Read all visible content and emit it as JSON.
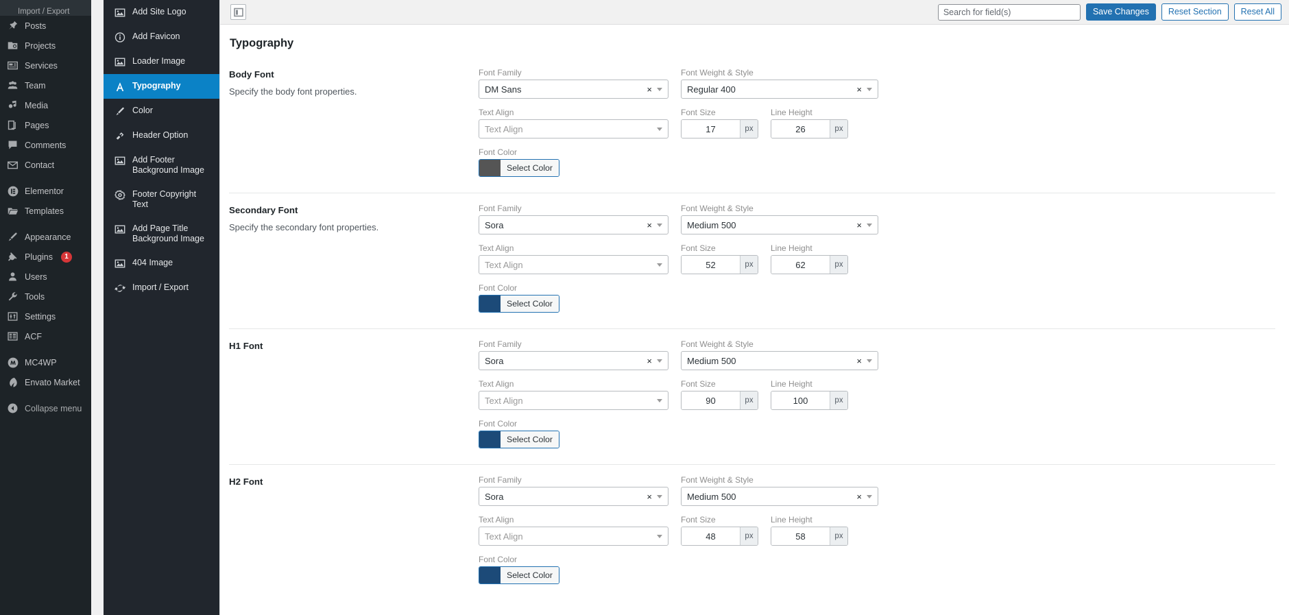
{
  "wp_sidebar": {
    "breadcrumb": "Import / Export",
    "items": [
      {
        "label": "Posts",
        "icon": "pin-icon",
        "name": "posts",
        "sep": false,
        "dim": false
      },
      {
        "label": "Projects",
        "icon": "projects-icon",
        "name": "projects",
        "sep": false,
        "dim": false
      },
      {
        "label": "Services",
        "icon": "services-icon",
        "name": "services",
        "sep": false,
        "dim": false
      },
      {
        "label": "Team",
        "icon": "team-icon",
        "name": "team",
        "sep": false,
        "dim": false
      },
      {
        "label": "Media",
        "icon": "media-icon",
        "name": "media",
        "sep": false,
        "dim": false
      },
      {
        "label": "Pages",
        "icon": "pages-icon",
        "name": "pages",
        "sep": false,
        "dim": false
      },
      {
        "label": "Comments",
        "icon": "comments-icon",
        "name": "comments",
        "sep": false,
        "dim": false
      },
      {
        "label": "Contact",
        "icon": "mail-icon",
        "name": "contact",
        "sep": false,
        "dim": false
      },
      {
        "label": "Elementor",
        "icon": "elementor-icon",
        "name": "elementor",
        "sep": true,
        "dim": false
      },
      {
        "label": "Templates",
        "icon": "folder-icon",
        "name": "templates",
        "sep": false,
        "dim": false
      },
      {
        "label": "Appearance",
        "icon": "brush-icon",
        "name": "appearance",
        "sep": true,
        "dim": false
      },
      {
        "label": "Plugins",
        "icon": "plug-icon",
        "name": "plugins",
        "sep": false,
        "dim": false,
        "badge": "1"
      },
      {
        "label": "Users",
        "icon": "user-icon",
        "name": "users",
        "sep": false,
        "dim": false
      },
      {
        "label": "Tools",
        "icon": "wrench-icon",
        "name": "tools",
        "sep": false,
        "dim": false
      },
      {
        "label": "Settings",
        "icon": "sliders-icon",
        "name": "settings",
        "sep": false,
        "dim": false
      },
      {
        "label": "ACF",
        "icon": "acf-icon",
        "name": "acf",
        "sep": false,
        "dim": false
      },
      {
        "label": "MC4WP",
        "icon": "mc4wp-icon",
        "name": "mc4wp",
        "sep": true,
        "dim": false
      },
      {
        "label": "Envato Market",
        "icon": "envato-icon",
        "name": "envato-market",
        "sep": false,
        "dim": false
      },
      {
        "label": "Collapse menu",
        "icon": "collapse-icon",
        "name": "collapse-menu",
        "sep": true,
        "dim": true
      }
    ]
  },
  "options_sidebar": {
    "items": [
      {
        "label": "Add Site Logo",
        "icon": "image-icon",
        "name": "add-site-logo",
        "active": false
      },
      {
        "label": "Add Favicon",
        "icon": "info-icon",
        "name": "add-favicon",
        "active": false
      },
      {
        "label": "Loader Image",
        "icon": "image-icon",
        "name": "loader-image",
        "active": false
      },
      {
        "label": "Typography",
        "icon": "typography-icon",
        "name": "typography",
        "active": true
      },
      {
        "label": "Color",
        "icon": "brush-icon",
        "name": "color",
        "active": false
      },
      {
        "label": "Header Option",
        "icon": "link-icon",
        "name": "header-option",
        "active": false
      },
      {
        "label": "Add Footer Background Image",
        "icon": "image-icon",
        "name": "add-footer-background-image",
        "active": false
      },
      {
        "label": "Footer Copyright Text",
        "icon": "gear-icon",
        "name": "footer-copyright-text",
        "active": false
      },
      {
        "label": "Add Page Title Background Image",
        "icon": "image-icon",
        "name": "add-page-title-background-image",
        "active": false
      },
      {
        "label": "404 Image",
        "icon": "image-icon",
        "name": "404-image",
        "active": false
      },
      {
        "label": "Import / Export",
        "icon": "refresh-icon",
        "name": "import-export",
        "active": false
      }
    ]
  },
  "topbar": {
    "expand_icon": "expand-panel-icon",
    "search_placeholder": "Search for field(s)",
    "search_value": "",
    "save_label": "Save Changes",
    "reset_section_label": "Reset Section",
    "reset_all_label": "Reset All"
  },
  "page": {
    "title": "Typography",
    "labels": {
      "font_family": "Font Family",
      "font_weight_style": "Font Weight & Style",
      "text_align": "Text Align",
      "font_size": "Font Size",
      "line_height": "Line Height",
      "font_color": "Font Color",
      "select_color": "Select Color",
      "unit_px": "px",
      "clear": "×"
    },
    "sections": [
      {
        "name": "body-font",
        "title": "Body Font",
        "desc": "Specify the body font properties.",
        "font_family": "DM Sans",
        "font_weight": "Regular 400",
        "text_align_placeholder": "Text Align",
        "font_size": "17",
        "line_height": "26",
        "color": "#555555"
      },
      {
        "name": "secondary-font",
        "title": "Secondary Font",
        "desc": "Specify the secondary font properties.",
        "font_family": "Sora",
        "font_weight": "Medium 500",
        "text_align_placeholder": "Text Align",
        "font_size": "52",
        "line_height": "62",
        "color": "#1c4a78"
      },
      {
        "name": "h1-font",
        "title": "H1 Font",
        "desc": "",
        "font_family": "Sora",
        "font_weight": "Medium 500",
        "text_align_placeholder": "Text Align",
        "font_size": "90",
        "line_height": "100",
        "color": "#1c4a78"
      },
      {
        "name": "h2-font",
        "title": "H2 Font",
        "desc": "",
        "font_family": "Sora",
        "font_weight": "Medium 500",
        "text_align_placeholder": "Text Align",
        "font_size": "48",
        "line_height": "58",
        "color": "#1c4a78"
      }
    ]
  },
  "colors": {
    "accent_blue": "#2271b1",
    "active_menu": "#0b82c6",
    "admin_bg": "#1d2327",
    "options_bg": "#21262d",
    "badge_red": "#d63638"
  }
}
